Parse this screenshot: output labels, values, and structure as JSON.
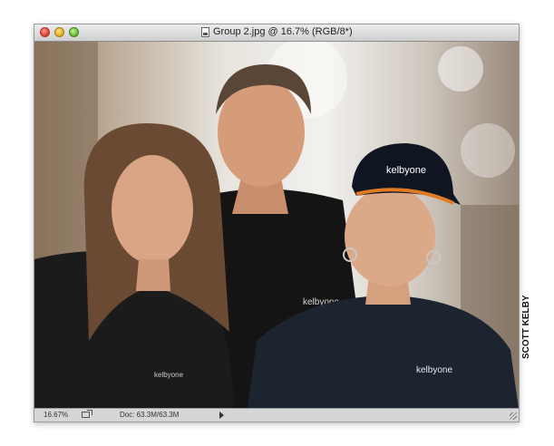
{
  "window": {
    "title": "Group 2.jpg @ 16.7% (RGB/8*)"
  },
  "statusbar": {
    "zoom": "16.67%",
    "doc_size": "Doc: 63.3M/63.3M"
  },
  "photo": {
    "cap_logo": "kelbyone",
    "shirt_logo_left": "kelbyone",
    "shirt_logo_right": "kelbyone"
  },
  "credit": "SCOTT KELBY",
  "colors": {
    "close": "#e0463a",
    "minimize": "#e8b22a",
    "maximize": "#6cc13a",
    "titlebar": "#dcdcdc",
    "statusbar": "#d6d6d6"
  }
}
